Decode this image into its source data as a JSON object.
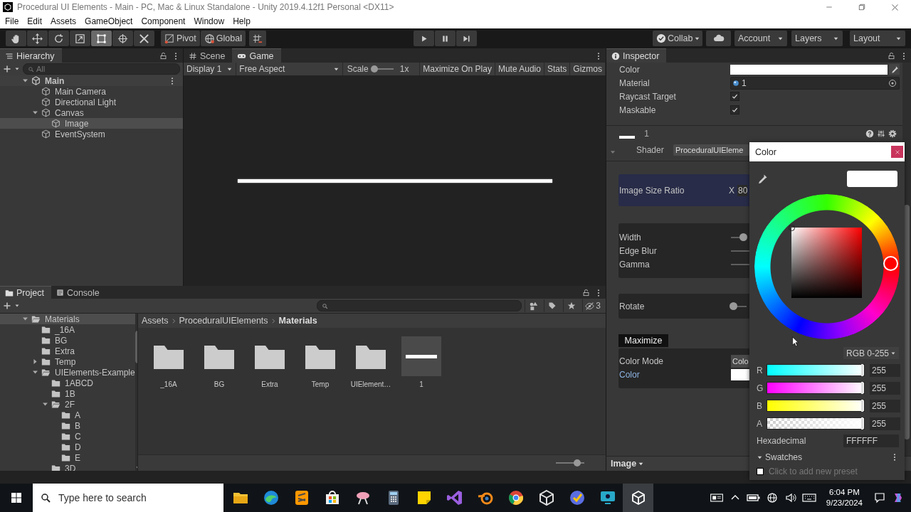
{
  "window": {
    "title": "Procedural UI Elements - Main - PC, Mac & Linux Standalone - Unity 2019.4.12f1 Personal <DX11>"
  },
  "menu": [
    "File",
    "Edit",
    "Assets",
    "GameObject",
    "Component",
    "Window",
    "Help"
  ],
  "toolbar": {
    "tools": [
      {
        "kind": "hand",
        "selected": false
      },
      {
        "kind": "move",
        "selected": false
      },
      {
        "kind": "rotate",
        "selected": false
      },
      {
        "kind": "scale",
        "selected": false
      },
      {
        "kind": "rect",
        "selected": true
      },
      {
        "kind": "transform",
        "selected": false
      },
      {
        "kind": "custom",
        "selected": false
      }
    ],
    "pivot": "Pivot",
    "global": "Global",
    "collab": "Collab",
    "account": "Account",
    "layers": "Layers",
    "layout": "Layout"
  },
  "hierarchy": {
    "tab": "Hierarchy",
    "search_placeholder": "All",
    "tree": [
      {
        "label": "Main",
        "kind": "scene",
        "expanded": true,
        "selected": false,
        "children": [
          {
            "label": "Main Camera",
            "kind": "object",
            "selected": false
          },
          {
            "label": "Directional Light",
            "kind": "object",
            "selected": false
          },
          {
            "label": "Canvas",
            "kind": "object",
            "expanded": true,
            "selected": false,
            "children": [
              {
                "label": "Image",
                "kind": "object",
                "selected": true
              }
            ]
          },
          {
            "label": "EventSystem",
            "kind": "object",
            "selected": false
          }
        ]
      }
    ]
  },
  "game_view": {
    "tabs": [
      {
        "label": "Scene",
        "kind": "scene",
        "selected": false
      },
      {
        "label": "Game",
        "kind": "game",
        "selected": true
      }
    ],
    "display": "Display 1",
    "aspect": "Free Aspect",
    "scale_label": "Scale",
    "scale_slider": {
      "level": 0.1
    },
    "scale_value": "1x",
    "toggles": [
      "Maximize On Play",
      "Mute Audio",
      "Stats",
      "Gizmos"
    ]
  },
  "project": {
    "tabs": [
      {
        "label": "Project",
        "kind": "project",
        "selected": true
      },
      {
        "label": "Console",
        "kind": "console",
        "selected": false
      }
    ],
    "hidden_count": "3",
    "tree": [
      {
        "label": "Materials",
        "expanded": true,
        "selected": true,
        "children": [
          {
            "label": "_16A",
            "selected": false
          },
          {
            "label": "BG",
            "selected": false
          },
          {
            "label": "Extra",
            "selected": false
          },
          {
            "label": "Temp",
            "expanded": false,
            "selected": false
          },
          {
            "label": "UIElements-Example",
            "expanded": true,
            "selected": false,
            "children": [
              {
                "label": "1ABCD",
                "selected": false
              },
              {
                "label": "1B",
                "selected": false
              },
              {
                "label": "2F",
                "expanded": true,
                "selected": false,
                "children": [
                  {
                    "label": "A",
                    "selected": false
                  },
                  {
                    "label": "B",
                    "selected": false
                  },
                  {
                    "label": "C",
                    "selected": false
                  },
                  {
                    "label": "D",
                    "selected": false
                  },
                  {
                    "label": "E",
                    "selected": false
                  }
                ]
              },
              {
                "label": "3D",
                "selected": false
              }
            ]
          }
        ]
      }
    ],
    "breadcrumb": [
      "Assets",
      "ProceduralUIElements",
      "Materials"
    ],
    "assets": [
      {
        "label": "_16A",
        "kind": "folder",
        "selected": false
      },
      {
        "label": "BG",
        "kind": "folder",
        "selected": false
      },
      {
        "label": "Extra",
        "kind": "folder",
        "selected": false
      },
      {
        "label": "Temp",
        "kind": "folder",
        "selected": false
      },
      {
        "label": "UIElement…",
        "kind": "folder",
        "selected": false
      },
      {
        "label": "1",
        "kind": "material",
        "selected": false
      }
    ],
    "zoom_slider": {
      "level": 0.75
    }
  },
  "inspector": {
    "tab": "Inspector",
    "fields": [
      {
        "kind": "color",
        "label": "Color"
      },
      {
        "kind": "object",
        "label": "Material",
        "value": "1"
      },
      {
        "kind": "checkbox",
        "label": "Raycast Target",
        "checked": true
      },
      {
        "kind": "checkbox",
        "label": "Maskable",
        "checked": true
      }
    ],
    "material": {
      "name": "1",
      "expanded": true,
      "shader_label": "Shader",
      "shader": "ProceduralUIEleme"
    },
    "size_ratio": {
      "label": "Image Size Ratio",
      "axis": "X",
      "value": "80"
    },
    "sliders": [
      {
        "label": "Width",
        "level": 0.78
      },
      {
        "label": "Edge Blur"
      },
      {
        "label": "Gamma"
      }
    ],
    "rotate": {
      "label": "Rotate",
      "level": 0.12
    },
    "maximize": "Maximize",
    "color_mode": {
      "label": "Color Mode",
      "value": "Colo"
    },
    "color_label": "Color",
    "footer": "Image"
  },
  "color_picker": {
    "title": "Color",
    "mode": "RGB 0-255",
    "channels": [
      {
        "kind": "r",
        "label": "R",
        "value": "255",
        "level": 1
      },
      {
        "kind": "g",
        "label": "G",
        "value": "255",
        "level": 1
      },
      {
        "kind": "b",
        "label": "B",
        "value": "255",
        "level": 1
      },
      {
        "kind": "a",
        "label": "A",
        "value": "255",
        "level": 1
      }
    ],
    "hex_label": "Hexadecimal",
    "hex": "FFFFFF",
    "swatches": {
      "label": "Swatches",
      "expanded": true,
      "hint": "Click to add new preset"
    }
  },
  "taskbar": {
    "search_placeholder": "Type here to search",
    "apps": [
      {
        "kind": "files",
        "selected": false
      },
      {
        "kind": "browser",
        "selected": false
      },
      {
        "kind": "editor",
        "selected": false
      },
      {
        "kind": "store",
        "selected": false
      },
      {
        "kind": "snip",
        "selected": false
      },
      {
        "kind": "calculator",
        "selected": false
      },
      {
        "kind": "notes",
        "selected": false
      },
      {
        "kind": "ide",
        "selected": false
      },
      {
        "kind": "ring",
        "selected": false
      },
      {
        "kind": "chrome",
        "selected": false
      },
      {
        "kind": "hub",
        "selected": false
      },
      {
        "kind": "check",
        "selected": false
      },
      {
        "kind": "monitor",
        "selected": false
      },
      {
        "kind": "unity",
        "selected": true
      }
    ],
    "tray": [
      {
        "kind": "news"
      },
      {
        "kind": "chevron"
      },
      {
        "kind": "battery"
      },
      {
        "kind": "globe"
      },
      {
        "kind": "volume"
      },
      {
        "kind": "keyboard"
      }
    ],
    "time": "6:04 PM",
    "date": "9/23/2024"
  }
}
